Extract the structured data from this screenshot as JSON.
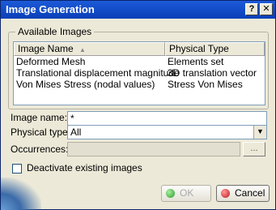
{
  "window": {
    "title": "Image Generation"
  },
  "titlebar": {
    "help_label": "?",
    "close_label": "✕"
  },
  "group": {
    "label": "Available Images"
  },
  "list": {
    "columns": [
      "Image Name",
      "Physical Type"
    ],
    "rows": [
      {
        "name": "Deformed Mesh",
        "type": "Elements set"
      },
      {
        "name": "Translational displacement magnitude",
        "type": "3D translation vector"
      },
      {
        "name": "Von Mises Stress (nodal values)",
        "type": "Stress Von Mises"
      }
    ]
  },
  "form": {
    "image_name_label": "Image name:",
    "image_name_value": "*",
    "physical_type_label": "Physical type:",
    "physical_type_value": "All",
    "occurrences_label": "Occurrences:",
    "occurrences_value": "",
    "browse_label": "..."
  },
  "checkbox": {
    "label": "Deactivate existing images",
    "checked": false
  },
  "buttons": {
    "ok_label": "OK",
    "cancel_label": "Cancel"
  },
  "icons": {
    "sort": "sort-asc-icon",
    "dropdown": "chevron-down-icon",
    "ok": "green-dot-icon",
    "cancel": "red-dot-icon"
  }
}
